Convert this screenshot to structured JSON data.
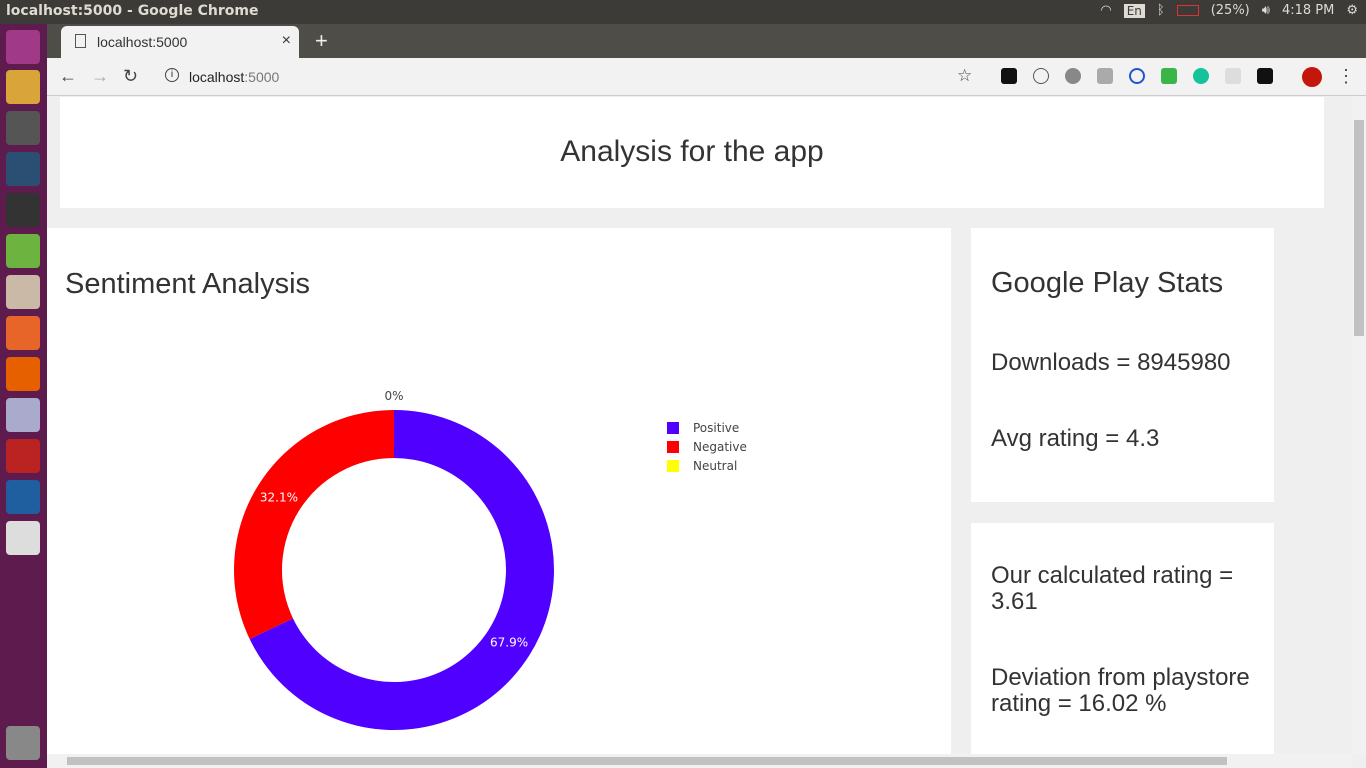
{
  "os": {
    "window_title": "localhost:5000 - Google Chrome",
    "lang": "En",
    "battery": "(25%)",
    "time": "4:18 PM"
  },
  "browser": {
    "tab_title": "localhost:5000",
    "url_host": "localhost",
    "url_port": ":5000"
  },
  "page": {
    "header": "Analysis for the app",
    "sentiment_title": "Sentiment Analysis",
    "stats_title": "Google Play Stats",
    "downloads": "Downloads = 8945980",
    "avg_rating": "Avg rating = 4.3",
    "calculated": "Our calculated rating = 3.61",
    "deviation": "Deviation from playstore rating = 16.02 %"
  },
  "chart_data": {
    "type": "pie",
    "hole": 0.7,
    "labels": [
      "Positive",
      "Negative",
      "Neutral"
    ],
    "values": [
      67.9,
      32.1,
      0
    ],
    "text_labels": [
      "67.9%",
      "32.1%",
      "0%"
    ],
    "colors": [
      "#5000ff",
      "#ff0000",
      "#ffff00"
    ],
    "legend": "right"
  }
}
